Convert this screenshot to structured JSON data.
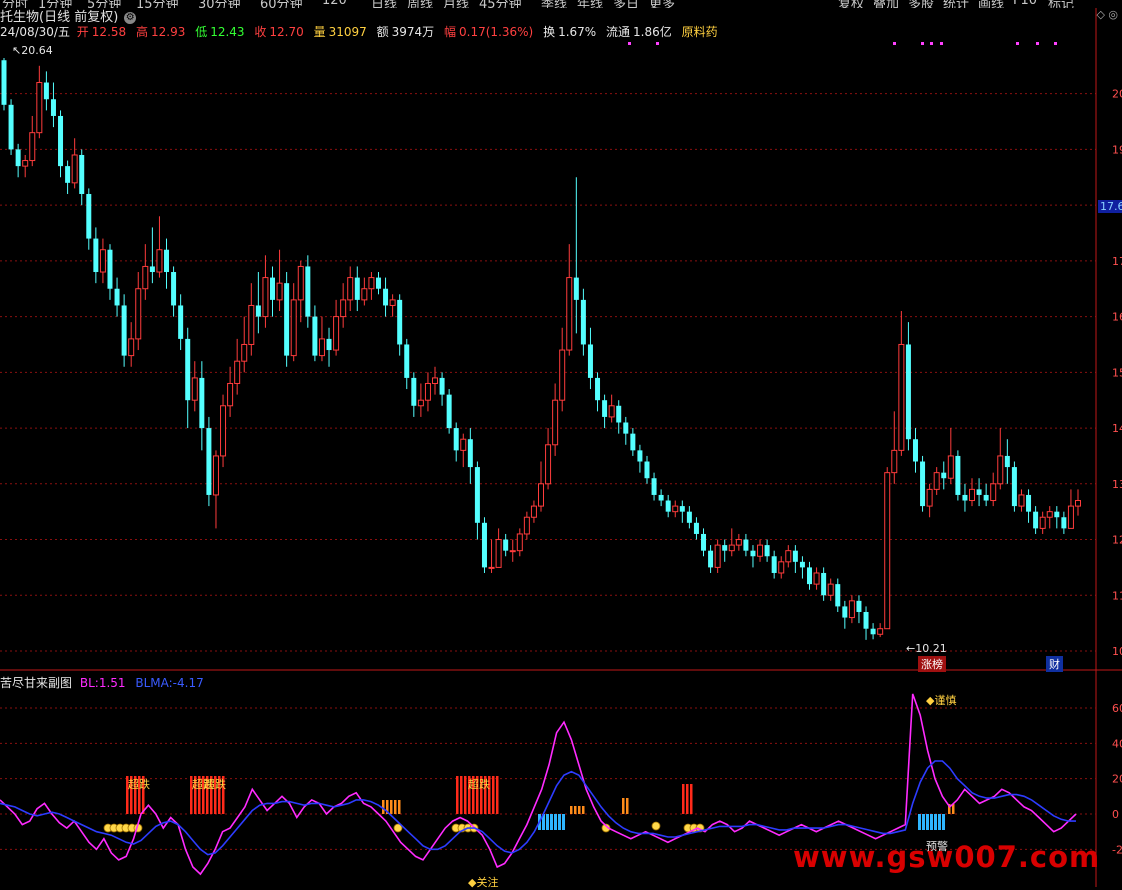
{
  "menu": [
    "分时",
    "1分钟",
    "5分钟",
    "15分钟",
    "30分钟",
    "60分钟",
    "120",
    "日线",
    "周线",
    "月线",
    "45分钟",
    "季线",
    "年线",
    "多日",
    "更多"
  ],
  "menu_right": [
    "复权",
    "叠加",
    "多股",
    "统计",
    "画线",
    "F10",
    "标记"
  ],
  "header": {
    "stock_name": "托生物(日线 前复权)",
    "gear_icon": "settings-icon",
    "window_icons": "◇ ◎"
  },
  "info": {
    "date": "24/08/30/五",
    "open_label": "开",
    "open": "12.58",
    "high_label": "高",
    "high": "12.93",
    "low_label": "低",
    "low": "12.43",
    "close_label": "收",
    "close": "12.70",
    "vol_label": "量",
    "vol": "31097",
    "amt_label": "额",
    "amt": "3974万",
    "chg_label": "幅",
    "chg": "0.17(1.36%)",
    "turn_label": "换",
    "turn": "1.67%",
    "float_label": "流通",
    "float": "1.86亿",
    "industry": "原料药"
  },
  "main_labels": {
    "high_mark": "20.64",
    "low_mark": "10.21",
    "price_tag": "17.6",
    "limit_up": "涨榜",
    "finance": "财"
  },
  "indicator": {
    "name": "苦尽甘来副图",
    "bl_label": "BL:",
    "bl_value": "1.51",
    "blma_label": "BLMA:",
    "blma_value": "-4.17",
    "tags": {
      "chaodie": "超跌",
      "jinshen": "谨慎",
      "guanzhu": "关注",
      "yujing": "预警"
    }
  },
  "watermark": "www.gsw007.com",
  "colors": {
    "up": "#ff3c3c",
    "down": "#54ffff",
    "bl": "#ff2bff",
    "blma": "#2d3cff",
    "grid": "#8a1010",
    "axis": "#c01818",
    "orange": "#ff8c1a",
    "sky": "#2fb6ff"
  },
  "chart_data": [
    {
      "type": "candlestick",
      "title": "托生物(日线 前复权)",
      "y_ticks": [
        "20",
        "19",
        "18",
        "17",
        "16",
        "15",
        "14",
        "13",
        "12",
        "11",
        "10"
      ],
      "ylim": [
        10,
        20.8
      ],
      "annotations": {
        "high": 20.64,
        "low": 10.21
      },
      "candles": [
        [
          20.6,
          19.8,
          20.64,
          19.7
        ],
        [
          19.8,
          19.0,
          19.9,
          18.9
        ],
        [
          19.0,
          18.7,
          19.1,
          18.5
        ],
        [
          18.7,
          18.8,
          18.9,
          18.5
        ],
        [
          18.8,
          19.3,
          19.6,
          18.7
        ],
        [
          19.3,
          20.2,
          20.5,
          19.2
        ],
        [
          20.2,
          19.9,
          20.4,
          19.7
        ],
        [
          19.9,
          19.6,
          20.2,
          19.4
        ],
        [
          19.6,
          18.7,
          19.7,
          18.5
        ],
        [
          18.7,
          18.4,
          18.8,
          18.2
        ],
        [
          18.4,
          18.9,
          19.2,
          18.3
        ],
        [
          18.9,
          18.2,
          19.0,
          18.0
        ],
        [
          18.2,
          17.4,
          18.3,
          17.2
        ],
        [
          17.4,
          16.8,
          17.6,
          16.6
        ],
        [
          16.8,
          17.2,
          17.4,
          16.6
        ],
        [
          17.2,
          16.5,
          17.3,
          16.3
        ],
        [
          16.5,
          16.2,
          16.7,
          16.0
        ],
        [
          16.2,
          15.3,
          16.4,
          15.1
        ],
        [
          15.3,
          15.6,
          15.9,
          15.1
        ],
        [
          15.6,
          16.5,
          16.8,
          15.4
        ],
        [
          16.5,
          16.9,
          17.3,
          16.3
        ],
        [
          16.9,
          16.8,
          17.6,
          16.6
        ],
        [
          16.8,
          17.2,
          17.8,
          16.7
        ],
        [
          17.2,
          16.8,
          17.4,
          16.5
        ],
        [
          16.8,
          16.2,
          16.9,
          16.0
        ],
        [
          16.2,
          15.6,
          16.4,
          15.4
        ],
        [
          15.6,
          14.5,
          15.8,
          14.0
        ],
        [
          14.5,
          14.9,
          15.2,
          14.3
        ],
        [
          14.9,
          14.0,
          15.2,
          13.6
        ],
        [
          14.0,
          12.8,
          14.2,
          12.6
        ],
        [
          12.8,
          13.5,
          13.6,
          12.2
        ],
        [
          13.5,
          14.4,
          14.6,
          13.3
        ],
        [
          14.4,
          14.8,
          15.1,
          14.2
        ],
        [
          14.8,
          15.2,
          15.6,
          14.6
        ],
        [
          15.2,
          15.5,
          16.0,
          15.0
        ],
        [
          15.5,
          16.2,
          16.6,
          15.3
        ],
        [
          16.2,
          16.0,
          16.8,
          15.7
        ],
        [
          16.0,
          16.7,
          17.1,
          15.8
        ],
        [
          16.7,
          16.3,
          16.9,
          16.0
        ],
        [
          16.3,
          16.6,
          17.2,
          16.1
        ],
        [
          16.6,
          15.3,
          16.8,
          15.1
        ],
        [
          15.3,
          16.3,
          16.6,
          15.2
        ],
        [
          16.3,
          16.9,
          17.0,
          15.9
        ],
        [
          16.9,
          16.0,
          17.1,
          15.8
        ],
        [
          16.0,
          15.3,
          16.2,
          15.2
        ],
        [
          15.3,
          15.6,
          16.0,
          15.2
        ],
        [
          15.6,
          15.4,
          15.8,
          15.1
        ],
        [
          15.4,
          16.0,
          16.3,
          15.3
        ],
        [
          16.0,
          16.3,
          16.6,
          15.8
        ],
        [
          16.3,
          16.7,
          16.9,
          16.1
        ],
        [
          16.7,
          16.3,
          16.9,
          16.1
        ],
        [
          16.3,
          16.5,
          16.7,
          16.2
        ],
        [
          16.5,
          16.7,
          16.8,
          16.3
        ],
        [
          16.7,
          16.5,
          16.8,
          16.4
        ],
        [
          16.5,
          16.2,
          16.7,
          16.0
        ],
        [
          16.2,
          16.3,
          16.4,
          16.0
        ],
        [
          16.3,
          15.5,
          16.4,
          15.3
        ],
        [
          15.5,
          14.9,
          15.6,
          14.7
        ],
        [
          14.9,
          14.4,
          15.0,
          14.2
        ],
        [
          14.4,
          14.5,
          14.8,
          14.2
        ],
        [
          14.5,
          14.8,
          15.0,
          14.3
        ],
        [
          14.8,
          14.9,
          15.1,
          14.6
        ],
        [
          14.9,
          14.6,
          15.0,
          14.4
        ],
        [
          14.6,
          14.0,
          14.7,
          13.9
        ],
        [
          14.0,
          13.6,
          14.1,
          13.4
        ],
        [
          13.6,
          13.8,
          13.9,
          13.3
        ],
        [
          13.8,
          13.3,
          14.0,
          13.0
        ],
        [
          13.3,
          12.3,
          13.4,
          12.0
        ],
        [
          12.3,
          11.5,
          12.4,
          11.4
        ],
        [
          11.5,
          11.5,
          12.0,
          11.4
        ],
        [
          11.5,
          12.0,
          12.2,
          11.7
        ],
        [
          12.0,
          11.8,
          12.1,
          11.7
        ],
        [
          11.8,
          11.8,
          12.0,
          11.6
        ],
        [
          11.8,
          12.1,
          12.2,
          11.7
        ],
        [
          12.1,
          12.4,
          12.5,
          12.0
        ],
        [
          12.4,
          12.6,
          12.7,
          12.3
        ],
        [
          12.6,
          13.0,
          13.4,
          12.5
        ],
        [
          13.0,
          13.7,
          14.0,
          12.9
        ],
        [
          13.7,
          14.5,
          14.8,
          13.5
        ],
        [
          14.5,
          15.4,
          15.8,
          14.3
        ],
        [
          15.4,
          16.7,
          17.3,
          15.3
        ],
        [
          16.7,
          16.3,
          18.5,
          15.7
        ],
        [
          16.3,
          15.5,
          16.5,
          15.3
        ],
        [
          15.5,
          14.9,
          15.8,
          14.7
        ],
        [
          14.9,
          14.5,
          15.0,
          14.3
        ],
        [
          14.5,
          14.2,
          14.6,
          14.0
        ],
        [
          14.2,
          14.4,
          14.6,
          14.1
        ],
        [
          14.4,
          14.1,
          14.5,
          13.9
        ],
        [
          14.1,
          13.9,
          14.2,
          13.7
        ],
        [
          13.9,
          13.6,
          14.0,
          13.5
        ],
        [
          13.6,
          13.4,
          13.7,
          13.2
        ],
        [
          13.4,
          13.1,
          13.5,
          13.0
        ],
        [
          13.1,
          12.8,
          13.2,
          12.7
        ],
        [
          12.8,
          12.7,
          12.9,
          12.6
        ],
        [
          12.7,
          12.5,
          12.8,
          12.4
        ],
        [
          12.5,
          12.6,
          12.7,
          12.4
        ],
        [
          12.6,
          12.5,
          12.7,
          12.3
        ],
        [
          12.5,
          12.3,
          12.6,
          12.2
        ],
        [
          12.3,
          12.1,
          12.4,
          12.0
        ],
        [
          12.1,
          11.8,
          12.2,
          11.7
        ],
        [
          11.8,
          11.5,
          11.9,
          11.4
        ],
        [
          11.5,
          11.9,
          12.0,
          11.4
        ],
        [
          11.9,
          11.8,
          12.0,
          11.6
        ],
        [
          11.8,
          11.9,
          12.2,
          11.7
        ],
        [
          11.9,
          12.0,
          12.1,
          11.8
        ],
        [
          12.0,
          11.8,
          12.1,
          11.7
        ],
        [
          11.8,
          11.7,
          11.9,
          11.5
        ],
        [
          11.7,
          11.9,
          12.0,
          11.6
        ],
        [
          11.9,
          11.7,
          12.0,
          11.6
        ],
        [
          11.7,
          11.4,
          11.8,
          11.3
        ],
        [
          11.4,
          11.6,
          11.7,
          11.3
        ],
        [
          11.6,
          11.8,
          11.9,
          11.5
        ],
        [
          11.8,
          11.6,
          11.9,
          11.4
        ],
        [
          11.6,
          11.5,
          11.7,
          11.3
        ],
        [
          11.5,
          11.2,
          11.6,
          11.1
        ],
        [
          11.2,
          11.4,
          11.5,
          11.1
        ],
        [
          11.4,
          11.0,
          11.5,
          10.9
        ],
        [
          11.0,
          11.2,
          11.3,
          10.9
        ],
        [
          11.2,
          10.8,
          11.3,
          10.7
        ],
        [
          10.8,
          10.6,
          10.9,
          10.4
        ],
        [
          10.6,
          10.9,
          11.0,
          10.5
        ],
        [
          10.9,
          10.7,
          11.0,
          10.5
        ],
        [
          10.7,
          10.4,
          10.8,
          10.2
        ],
        [
          10.4,
          10.3,
          10.5,
          10.21
        ],
        [
          10.3,
          10.4,
          10.5,
          10.25
        ],
        [
          10.4,
          13.2,
          13.3,
          10.4
        ],
        [
          13.2,
          13.6,
          14.3,
          13.0
        ],
        [
          13.6,
          15.5,
          16.1,
          13.5
        ],
        [
          15.5,
          13.8,
          15.9,
          13.6
        ],
        [
          13.8,
          13.4,
          14.0,
          13.2
        ],
        [
          13.4,
          12.6,
          13.5,
          12.5
        ],
        [
          12.6,
          12.9,
          13.0,
          12.4
        ],
        [
          12.9,
          13.2,
          13.3,
          12.8
        ],
        [
          13.2,
          13.1,
          13.4,
          12.9
        ],
        [
          13.1,
          13.5,
          14.0,
          13.0
        ],
        [
          13.5,
          12.8,
          13.6,
          12.7
        ],
        [
          12.8,
          12.7,
          13.0,
          12.5
        ],
        [
          12.7,
          12.9,
          13.1,
          12.6
        ],
        [
          12.9,
          12.8,
          13.1,
          12.6
        ],
        [
          12.8,
          12.7,
          13.0,
          12.6
        ],
        [
          12.7,
          13.0,
          13.2,
          12.6
        ],
        [
          13.0,
          13.5,
          14.0,
          12.9
        ],
        [
          13.5,
          13.3,
          13.8,
          13.0
        ],
        [
          13.3,
          12.6,
          13.4,
          12.5
        ],
        [
          12.6,
          12.8,
          12.9,
          12.5
        ],
        [
          12.8,
          12.5,
          12.9,
          12.3
        ],
        [
          12.5,
          12.2,
          12.6,
          12.1
        ],
        [
          12.2,
          12.4,
          12.5,
          12.1
        ],
        [
          12.4,
          12.5,
          12.6,
          12.2
        ],
        [
          12.5,
          12.4,
          12.6,
          12.2
        ],
        [
          12.4,
          12.2,
          12.5,
          12.1
        ],
        [
          12.2,
          12.6,
          12.9,
          12.2
        ],
        [
          12.6,
          12.7,
          12.9,
          12.43
        ]
      ]
    },
    {
      "type": "line",
      "title": "苦尽甘来副图",
      "y_ticks": [
        "60",
        "40",
        "20",
        "0",
        "-20"
      ],
      "ylim": [
        -28,
        76
      ],
      "series": [
        {
          "name": "BL",
          "values": [
            8,
            4,
            0,
            -6,
            -4,
            3,
            6,
            0,
            -5,
            -8,
            -4,
            -10,
            -16,
            -20,
            -14,
            -22,
            -26,
            -24,
            -14,
            0,
            5,
            0,
            -8,
            -2,
            -6,
            -20,
            -30,
            -34,
            -28,
            -20,
            -10,
            -8,
            -2,
            4,
            14,
            8,
            2,
            6,
            10,
            6,
            -2,
            4,
            8,
            6,
            0,
            4,
            6,
            10,
            12,
            6,
            4,
            0,
            -4,
            -10,
            -16,
            -20,
            -24,
            -26,
            -20,
            -14,
            -8,
            -4,
            -2,
            -4,
            -8,
            -12,
            -20,
            -30,
            -28,
            -22,
            -14,
            -6,
            4,
            14,
            28,
            46,
            52,
            42,
            28,
            14,
            4,
            -4,
            -8,
            -10,
            -12,
            -14,
            -12,
            -10,
            -12,
            -14,
            -16,
            -14,
            -12,
            -10,
            -8,
            -10,
            -6,
            -4,
            -6,
            -10,
            -8,
            -4,
            -6,
            -8,
            -10,
            -12,
            -10,
            -8,
            -6,
            -8,
            -10,
            -8,
            -6,
            -4,
            -6,
            -8,
            -10,
            -12,
            -14,
            -12,
            -10,
            -8,
            -6,
            68,
            56,
            36,
            20,
            10,
            4,
            8,
            14,
            10,
            6,
            8,
            10,
            14,
            12,
            8,
            4,
            2,
            -2,
            -6,
            -10,
            -8,
            -4,
            0
          ],
          "color": "#ff2bff"
        },
        {
          "name": "BLMA",
          "values": [
            6,
            5,
            4,
            2,
            0,
            -1,
            0,
            1,
            0,
            -2,
            -4,
            -6,
            -8,
            -10,
            -11,
            -12,
            -14,
            -16,
            -17,
            -15,
            -11,
            -7,
            -5,
            -4,
            -6,
            -10,
            -15,
            -20,
            -23,
            -22,
            -18,
            -13,
            -8,
            -3,
            2,
            5,
            6,
            6,
            7,
            7,
            6,
            5,
            6,
            6,
            5,
            4,
            5,
            6,
            8,
            8,
            7,
            5,
            2,
            -2,
            -6,
            -10,
            -14,
            -18,
            -20,
            -20,
            -18,
            -14,
            -10,
            -8,
            -8,
            -10,
            -14,
            -18,
            -21,
            -22,
            -20,
            -16,
            -10,
            -2,
            7,
            16,
            22,
            24,
            22,
            16,
            10,
            4,
            -1,
            -5,
            -8,
            -10,
            -11,
            -11,
            -11,
            -12,
            -13,
            -13,
            -12,
            -11,
            -10,
            -9,
            -8,
            -7,
            -7,
            -7,
            -7,
            -6,
            -6,
            -7,
            -8,
            -9,
            -9,
            -8,
            -8,
            -8,
            -8,
            -8,
            -7,
            -6,
            -6,
            -7,
            -8,
            -9,
            -10,
            -11,
            -11,
            -10,
            -9,
            6,
            18,
            26,
            30,
            30,
            26,
            20,
            16,
            12,
            10,
            9,
            9,
            10,
            11,
            11,
            10,
            8,
            5,
            2,
            -1,
            -3,
            -4,
            -4
          ],
          "color": "#2d3cff"
        }
      ]
    }
  ]
}
